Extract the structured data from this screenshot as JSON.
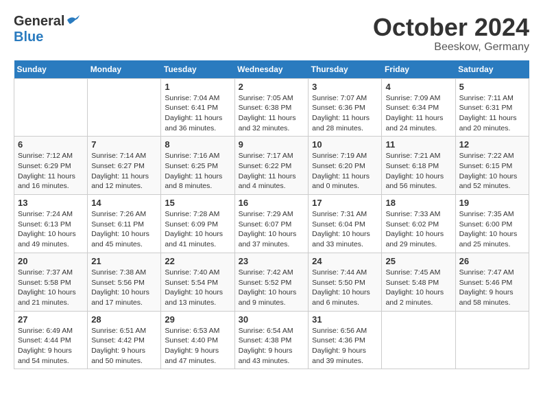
{
  "header": {
    "logo": {
      "general": "General",
      "blue": "Blue"
    },
    "title": "October 2024",
    "location": "Beeskow, Germany"
  },
  "calendar": {
    "weekdays": [
      "Sunday",
      "Monday",
      "Tuesday",
      "Wednesday",
      "Thursday",
      "Friday",
      "Saturday"
    ],
    "weeks": [
      [
        {
          "day": "",
          "info": ""
        },
        {
          "day": "",
          "info": ""
        },
        {
          "day": "1",
          "info": "Sunrise: 7:04 AM\nSunset: 6:41 PM\nDaylight: 11 hours\nand 36 minutes."
        },
        {
          "day": "2",
          "info": "Sunrise: 7:05 AM\nSunset: 6:38 PM\nDaylight: 11 hours\nand 32 minutes."
        },
        {
          "day": "3",
          "info": "Sunrise: 7:07 AM\nSunset: 6:36 PM\nDaylight: 11 hours\nand 28 minutes."
        },
        {
          "day": "4",
          "info": "Sunrise: 7:09 AM\nSunset: 6:34 PM\nDaylight: 11 hours\nand 24 minutes."
        },
        {
          "day": "5",
          "info": "Sunrise: 7:11 AM\nSunset: 6:31 PM\nDaylight: 11 hours\nand 20 minutes."
        }
      ],
      [
        {
          "day": "6",
          "info": "Sunrise: 7:12 AM\nSunset: 6:29 PM\nDaylight: 11 hours\nand 16 minutes."
        },
        {
          "day": "7",
          "info": "Sunrise: 7:14 AM\nSunset: 6:27 PM\nDaylight: 11 hours\nand 12 minutes."
        },
        {
          "day": "8",
          "info": "Sunrise: 7:16 AM\nSunset: 6:25 PM\nDaylight: 11 hours\nand 8 minutes."
        },
        {
          "day": "9",
          "info": "Sunrise: 7:17 AM\nSunset: 6:22 PM\nDaylight: 11 hours\nand 4 minutes."
        },
        {
          "day": "10",
          "info": "Sunrise: 7:19 AM\nSunset: 6:20 PM\nDaylight: 11 hours\nand 0 minutes."
        },
        {
          "day": "11",
          "info": "Sunrise: 7:21 AM\nSunset: 6:18 PM\nDaylight: 10 hours\nand 56 minutes."
        },
        {
          "day": "12",
          "info": "Sunrise: 7:22 AM\nSunset: 6:15 PM\nDaylight: 10 hours\nand 52 minutes."
        }
      ],
      [
        {
          "day": "13",
          "info": "Sunrise: 7:24 AM\nSunset: 6:13 PM\nDaylight: 10 hours\nand 49 minutes."
        },
        {
          "day": "14",
          "info": "Sunrise: 7:26 AM\nSunset: 6:11 PM\nDaylight: 10 hours\nand 45 minutes."
        },
        {
          "day": "15",
          "info": "Sunrise: 7:28 AM\nSunset: 6:09 PM\nDaylight: 10 hours\nand 41 minutes."
        },
        {
          "day": "16",
          "info": "Sunrise: 7:29 AM\nSunset: 6:07 PM\nDaylight: 10 hours\nand 37 minutes."
        },
        {
          "day": "17",
          "info": "Sunrise: 7:31 AM\nSunset: 6:04 PM\nDaylight: 10 hours\nand 33 minutes."
        },
        {
          "day": "18",
          "info": "Sunrise: 7:33 AM\nSunset: 6:02 PM\nDaylight: 10 hours\nand 29 minutes."
        },
        {
          "day": "19",
          "info": "Sunrise: 7:35 AM\nSunset: 6:00 PM\nDaylight: 10 hours\nand 25 minutes."
        }
      ],
      [
        {
          "day": "20",
          "info": "Sunrise: 7:37 AM\nSunset: 5:58 PM\nDaylight: 10 hours\nand 21 minutes."
        },
        {
          "day": "21",
          "info": "Sunrise: 7:38 AM\nSunset: 5:56 PM\nDaylight: 10 hours\nand 17 minutes."
        },
        {
          "day": "22",
          "info": "Sunrise: 7:40 AM\nSunset: 5:54 PM\nDaylight: 10 hours\nand 13 minutes."
        },
        {
          "day": "23",
          "info": "Sunrise: 7:42 AM\nSunset: 5:52 PM\nDaylight: 10 hours\nand 9 minutes."
        },
        {
          "day": "24",
          "info": "Sunrise: 7:44 AM\nSunset: 5:50 PM\nDaylight: 10 hours\nand 6 minutes."
        },
        {
          "day": "25",
          "info": "Sunrise: 7:45 AM\nSunset: 5:48 PM\nDaylight: 10 hours\nand 2 minutes."
        },
        {
          "day": "26",
          "info": "Sunrise: 7:47 AM\nSunset: 5:46 PM\nDaylight: 9 hours\nand 58 minutes."
        }
      ],
      [
        {
          "day": "27",
          "info": "Sunrise: 6:49 AM\nSunset: 4:44 PM\nDaylight: 9 hours\nand 54 minutes."
        },
        {
          "day": "28",
          "info": "Sunrise: 6:51 AM\nSunset: 4:42 PM\nDaylight: 9 hours\nand 50 minutes."
        },
        {
          "day": "29",
          "info": "Sunrise: 6:53 AM\nSunset: 4:40 PM\nDaylight: 9 hours\nand 47 minutes."
        },
        {
          "day": "30",
          "info": "Sunrise: 6:54 AM\nSunset: 4:38 PM\nDaylight: 9 hours\nand 43 minutes."
        },
        {
          "day": "31",
          "info": "Sunrise: 6:56 AM\nSunset: 4:36 PM\nDaylight: 9 hours\nand 39 minutes."
        },
        {
          "day": "",
          "info": ""
        },
        {
          "day": "",
          "info": ""
        }
      ]
    ]
  }
}
